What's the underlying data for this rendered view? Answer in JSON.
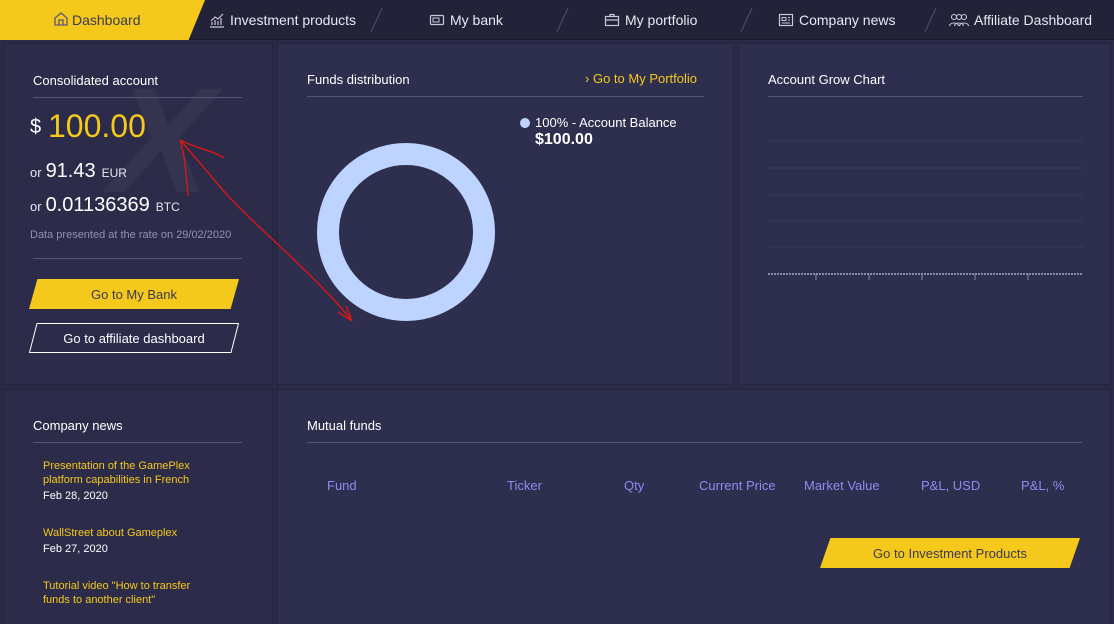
{
  "nav": {
    "items": [
      {
        "label": "Dashboard",
        "icon": "home-icon",
        "active": true
      },
      {
        "label": "Investment products",
        "icon": "chart-growth-icon"
      },
      {
        "label": "My bank",
        "icon": "wallet-icon"
      },
      {
        "label": "My portfolio",
        "icon": "briefcase-icon"
      },
      {
        "label": "Company news",
        "icon": "news-icon"
      },
      {
        "label": "Affiliate Dashboard",
        "icon": "users-icon"
      }
    ]
  },
  "account": {
    "title": "Consolidated account",
    "currency_symbol": "$",
    "amount": "100.00",
    "or_label": "or",
    "eur_value": "91.43",
    "eur_label": "EUR",
    "btc_value": "0.01136369",
    "btc_label": "BTC",
    "rate_note": "Data presented at the rate on 29/02/2020",
    "bank_button": "Go to My Bank",
    "affiliate_button": "Go to affiliate dashboard"
  },
  "funds": {
    "title": "Funds distribution",
    "portfolio_link": "Go to My Portfolio",
    "legend_label": "100% - Account Balance",
    "legend_value": "$100.00"
  },
  "grow": {
    "title": "Account Grow Chart"
  },
  "news": {
    "title": "Company news",
    "items": [
      {
        "title": "Presentation of the GamePlex platform capabilities in French",
        "date": "Feb 28, 2020"
      },
      {
        "title": "WallStreet about Gameplex",
        "date": "Feb 27, 2020"
      },
      {
        "title": "Tutorial video \"How to transfer funds to another client\"",
        "date": ""
      }
    ]
  },
  "mutual": {
    "title": "Mutual funds",
    "columns": [
      "Fund",
      "Ticker",
      "Qty",
      "Current Price",
      "Market Value",
      "P&L, USD",
      "P&L, %"
    ],
    "button": "Go to Investment Products"
  },
  "colors": {
    "accent": "#f5c81c",
    "background": "#2a2a48",
    "panel": "#2e2e4e",
    "header_link": "#8c8cf0",
    "donut": "#bcd4ff",
    "annotation": "#d01818"
  }
}
